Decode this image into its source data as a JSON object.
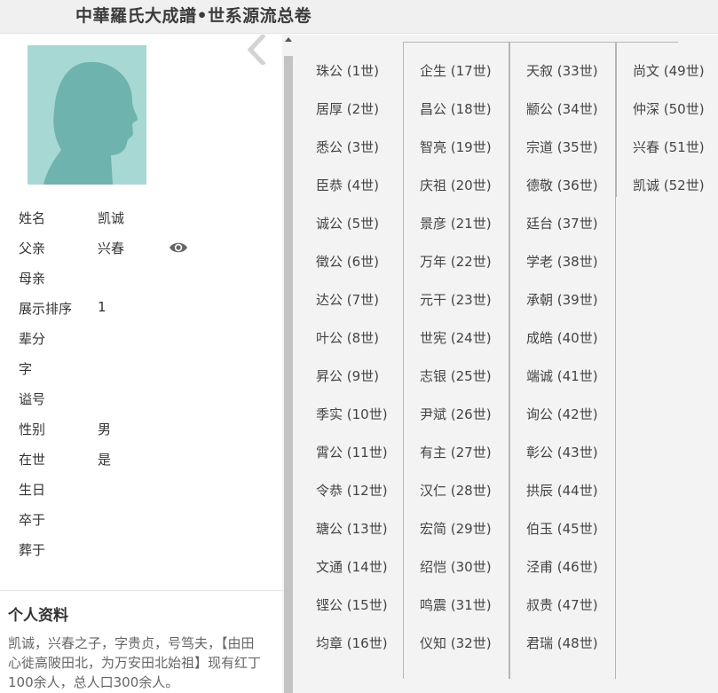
{
  "header": {
    "title": "中華羅氏大成譜•世系源流总卷"
  },
  "profile": {
    "fields": [
      {
        "label": "姓名",
        "value": "凯诚"
      },
      {
        "label": "父亲",
        "value": "兴春",
        "has_view": true
      },
      {
        "label": "母亲",
        "value": ""
      },
      {
        "label": "展示排序",
        "value": "1"
      },
      {
        "label": "辈分",
        "value": ""
      },
      {
        "label": "字",
        "value": ""
      },
      {
        "label": "谥号",
        "value": ""
      },
      {
        "label": "性别",
        "value": "男"
      },
      {
        "label": "在世",
        "value": "是"
      },
      {
        "label": "生日",
        "value": ""
      },
      {
        "label": "卒于",
        "value": ""
      },
      {
        "label": "葬于",
        "value": ""
      }
    ],
    "bio_title": "个人资料",
    "bio_text": "凯诚，兴春之子，字贵贞，号笃夫，【由田心徙高陂田北，为万安田北始祖】现有红丁100余人，总人口300余人。"
  },
  "generations": [
    [
      "珠公 (1世)",
      "居厚 (2世)",
      "悉公 (3世)",
      "臣恭 (4世)",
      "诚公 (5世)",
      "徵公 (6世)",
      "达公 (7世)",
      "叶公 (8世)",
      "昇公 (9世)",
      "季实 (10世)",
      "霄公 (11世)",
      "令恭 (12世)",
      "瑭公 (13世)",
      "文通 (14世)",
      "铿公 (15世)",
      "均章 (16世)"
    ],
    [
      "企生 (17世)",
      "昌公 (18世)",
      "智亮 (19世)",
      "庆祖 (20世)",
      "景彦 (21世)",
      "万年 (22世)",
      "元干 (23世)",
      "世宪 (24世)",
      "志银 (25世)",
      "尹斌 (26世)",
      "有主 (27世)",
      "汉仁 (28世)",
      "宏简 (29世)",
      "绍恺 (30世)",
      "鸣震 (31世)",
      "仪知 (32世)"
    ],
    [
      "天叙 (33世)",
      "颛公 (34世)",
      "宗道 (35世)",
      "德敬 (36世)",
      "廷台 (37世)",
      "学老 (38世)",
      "承朝 (39世)",
      "成皓 (40世)",
      "端诚 (41世)",
      "询公 (42世)",
      "彰公 (43世)",
      "拱辰 (44世)",
      "伯玉 (45世)",
      "泾甫 (46世)",
      "叔贵 (47世)",
      "君瑞 (48世)"
    ],
    [
      "尚文 (49世)",
      "仲深 (50世)",
      "兴春 (51世)",
      "凯诚 (52世)"
    ]
  ]
}
